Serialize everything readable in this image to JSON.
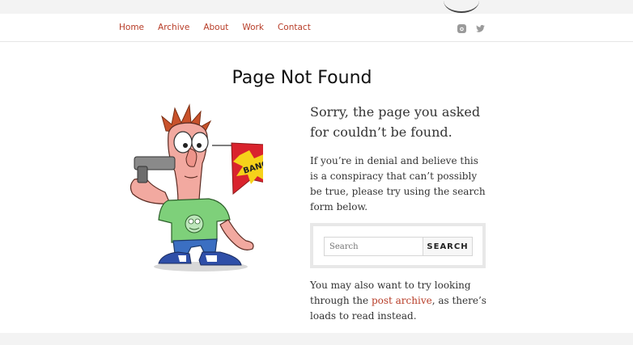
{
  "nav": {
    "items": [
      {
        "label": "Home"
      },
      {
        "label": "Archive"
      },
      {
        "label": "About"
      },
      {
        "label": "Work"
      },
      {
        "label": "Contact"
      }
    ],
    "social_icons": [
      "instagram-icon",
      "twitter-icon"
    ]
  },
  "page": {
    "title": "Page Not Found",
    "lead": "Sorry, the page you asked for couldn’t be found.",
    "body": "If you’re in denial and believe this is a conspiracy that can’t possibly be true, please try using the search form below.",
    "after_before_link": "You may also want to try looking through the ",
    "after_link": "post archive",
    "after_after_link": ", as there’s loads to read instead."
  },
  "search": {
    "placeholder": "Search",
    "button_label": "SEARCH"
  },
  "illustration": {
    "flag_text": "BANG!"
  },
  "colors": {
    "accent": "#b73c27",
    "strip": "#f3f3f3"
  }
}
